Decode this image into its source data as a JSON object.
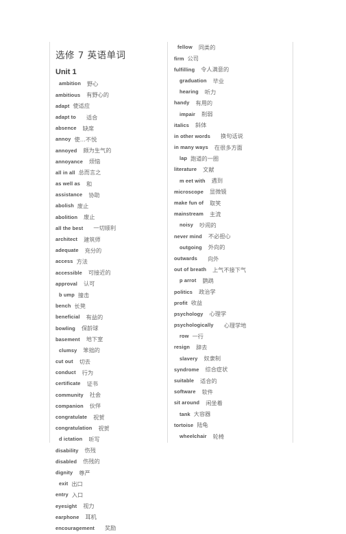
{
  "document": {
    "title": "选修 7  英语单词",
    "unit_heading": "Unit 1"
  },
  "columns": {
    "left": {
      "entries": [
        {
          "term": "ambition",
          "gloss": "野心",
          "indent": 1,
          "gap": "md"
        },
        {
          "term": "ambitious",
          "gloss": "有野心的",
          "indent": 0,
          "gap": "md"
        },
        {
          "term": "adapt",
          "gloss": "使适应",
          "indent": 0,
          "gap": "sm"
        },
        {
          "term": "adapt to",
          "gloss": "适合",
          "indent": 0,
          "gap": "lg"
        },
        {
          "term": "absence",
          "gloss": "缺席",
          "indent": 0,
          "gap": "md"
        },
        {
          "term": "annoy",
          "gloss": "使…不悦",
          "indent": 0,
          "gap": "sm"
        },
        {
          "term": "annoyed",
          "gloss": "颇为生气的",
          "indent": 0,
          "gap": "md"
        },
        {
          "term": "annoyance",
          "gloss": "烦恼",
          "indent": 0,
          "gap": "md"
        },
        {
          "term": "all in all",
          "gloss": "总而言之",
          "indent": 0,
          "gap": "sm"
        },
        {
          "term": "as well as",
          "gloss": "和",
          "indent": 0,
          "gap": "md"
        },
        {
          "term": "assistance",
          "gloss": "协助",
          "indent": 0,
          "gap": "md"
        },
        {
          "term": "abolish",
          "gloss": "废止",
          "indent": 0,
          "gap": "sm"
        },
        {
          "term": "abolition",
          "gloss": "废止",
          "indent": 0,
          "gap": "md"
        },
        {
          "term": "all the best",
          "gloss": "一切顺利",
          "indent": 0,
          "gap": "lg"
        },
        {
          "term": "architect",
          "gloss": "建筑师",
          "indent": 0,
          "gap": "md"
        },
        {
          "term": "adequate",
          "gloss": "充分的",
          "indent": 0,
          "gap": "md"
        },
        {
          "term": "access",
          "gloss": "方法",
          "indent": 0,
          "gap": "sm"
        },
        {
          "term": "accessible",
          "gloss": "可接近的",
          "indent": 0,
          "gap": "md"
        },
        {
          "term": "approval",
          "gloss": "认可",
          "indent": 0,
          "gap": "md"
        },
        {
          "term": "b ump",
          "gloss": "撞击",
          "indent": 1,
          "gap": "sm"
        },
        {
          "term": "bench",
          "gloss": "长凳",
          "indent": 0,
          "gap": "sm"
        },
        {
          "term": "beneficial",
          "gloss": "有益的",
          "indent": 0,
          "gap": "md"
        },
        {
          "term": "bowling",
          "gloss": "保龄球",
          "indent": 0,
          "gap": "md"
        },
        {
          "term": "basement",
          "gloss": "地下室",
          "indent": 0,
          "gap": "md"
        },
        {
          "term": "clumsy",
          "gloss": "笨拙的",
          "indent": 1,
          "gap": "md"
        },
        {
          "term": "cut out",
          "gloss": "切去",
          "indent": 0,
          "gap": "md"
        },
        {
          "term": "conduct",
          "gloss": "行为",
          "indent": 0,
          "gap": "md"
        },
        {
          "term": "certificate",
          "gloss": "证书",
          "indent": 0,
          "gap": "md"
        },
        {
          "term": "community",
          "gloss": "社会",
          "indent": 0,
          "gap": "md"
        },
        {
          "term": "companion",
          "gloss": "伙伴",
          "indent": 0,
          "gap": "md"
        },
        {
          "term": "congratulate",
          "gloss": "祝贺",
          "indent": 0,
          "gap": "md"
        },
        {
          "term": "congratulation",
          "gloss": "祝贺",
          "indent": 0,
          "gap": "md"
        },
        {
          "term": "d ictation",
          "gloss": "听写",
          "indent": 1,
          "gap": "md"
        },
        {
          "term": "disability",
          "gloss": "伤残",
          "indent": 0,
          "gap": "md"
        },
        {
          "term": "disabled",
          "gloss": "伤残的",
          "indent": 0,
          "gap": "md"
        },
        {
          "term": "dignity",
          "gloss": "尊严",
          "indent": 0,
          "gap": "md"
        },
        {
          "term": "exit",
          "gloss": "出口",
          "indent": 1,
          "gap": "sm"
        },
        {
          "term": "entry",
          "gloss": "入口",
          "indent": 0,
          "gap": "sm"
        },
        {
          "term": "eyesight",
          "gloss": "视力",
          "indent": 0,
          "gap": "md"
        },
        {
          "term": "earphone",
          "gloss": "耳机",
          "indent": 0,
          "gap": "md"
        },
        {
          "term": "encouragement",
          "gloss": "奖励",
          "indent": 0,
          "gap": "lg"
        }
      ]
    },
    "right": {
      "entries": [
        {
          "term": "fellow",
          "gloss": "同类的",
          "indent": 1,
          "gap": "md"
        },
        {
          "term": "firm",
          "gloss": "公司",
          "indent": 0,
          "gap": "sm"
        },
        {
          "term": "fulfilling",
          "gloss": "令人满意的",
          "indent": 0,
          "gap": "md"
        },
        {
          "term": "graduation",
          "gloss": "毕业",
          "indent": 2,
          "gap": "md"
        },
        {
          "term": "hearing",
          "gloss": "听力",
          "indent": 2,
          "gap": "md"
        },
        {
          "term": "handy",
          "gloss": "有用的",
          "indent": 0,
          "gap": "md"
        },
        {
          "term": "impair",
          "gloss": "削弱",
          "indent": 2,
          "gap": "md"
        },
        {
          "term": "italics",
          "gloss": "斜体",
          "indent": 0,
          "gap": "md"
        },
        {
          "term": "in other words",
          "gloss": "换句话说",
          "indent": 0,
          "gap": "lg"
        },
        {
          "term": "in many ways",
          "gloss": "在很多方面",
          "indent": 0,
          "gap": "md"
        },
        {
          "term": "lap",
          "gloss": "跑道的一圈",
          "indent": 2,
          "gap": "sm"
        },
        {
          "term": "literature",
          "gloss": "文献",
          "indent": 0,
          "gap": "md"
        },
        {
          "term": "m eet with",
          "gloss": "遇到",
          "indent": 2,
          "gap": "md"
        },
        {
          "term": "microscope",
          "gloss": "显微镜",
          "indent": 0,
          "gap": "md"
        },
        {
          "term": "make fun of",
          "gloss": "取笑",
          "indent": 0,
          "gap": "md"
        },
        {
          "term": "mainstream",
          "gloss": "主流",
          "indent": 0,
          "gap": "md"
        },
        {
          "term": "noisy",
          "gloss": "吵闹的",
          "indent": 2,
          "gap": "md"
        },
        {
          "term": "never mind",
          "gloss": "不必担心",
          "indent": 0,
          "gap": "md"
        },
        {
          "term": "outgoing",
          "gloss": "外向的",
          "indent": 2,
          "gap": "md"
        },
        {
          "term": "outwards",
          "gloss": "向外",
          "indent": 0,
          "gap": "lg"
        },
        {
          "term": "out of breath",
          "gloss": "上气不接下气",
          "indent": 0,
          "gap": "md"
        },
        {
          "term": "p arrot",
          "gloss": "鹦鹉",
          "indent": 2,
          "gap": "md"
        },
        {
          "term": "politics",
          "gloss": "政治学",
          "indent": 0,
          "gap": "md"
        },
        {
          "term": "profit",
          "gloss": "收益",
          "indent": 0,
          "gap": "sm"
        },
        {
          "term": "psychology",
          "gloss": "心理学",
          "indent": 0,
          "gap": "md"
        },
        {
          "term": "psychologically",
          "gloss": "心理学地",
          "indent": 0,
          "gap": "lg"
        },
        {
          "term": "row",
          "gloss": "一行",
          "indent": 2,
          "gap": "sm"
        },
        {
          "term": "resign",
          "gloss": "辞去",
          "indent": 0,
          "gap": "md"
        },
        {
          "term": "slavery",
          "gloss": "奴隶制",
          "indent": 2,
          "gap": "md"
        },
        {
          "term": "syndrome",
          "gloss": "综合症状",
          "indent": 0,
          "gap": "md"
        },
        {
          "term": "suitable",
          "gloss": "适合的",
          "indent": 0,
          "gap": "md"
        },
        {
          "term": "software",
          "gloss": "软件",
          "indent": 0,
          "gap": "md"
        },
        {
          "term": "sit around",
          "gloss": "闲坐着",
          "indent": 0,
          "gap": "md"
        },
        {
          "term": "tank",
          "gloss": "大容器",
          "indent": 2,
          "gap": "sm"
        },
        {
          "term": "tortoise",
          "gloss": "陆龟",
          "indent": 0,
          "gap": "sm"
        },
        {
          "term": "wheelchair",
          "gloss": "轮椅",
          "indent": 2,
          "gap": "md"
        }
      ]
    }
  },
  "colors": {
    "page_background": "#ffffff",
    "text": "#555555",
    "heading": "#4a4a4a",
    "rule": "#dcdcdc"
  }
}
